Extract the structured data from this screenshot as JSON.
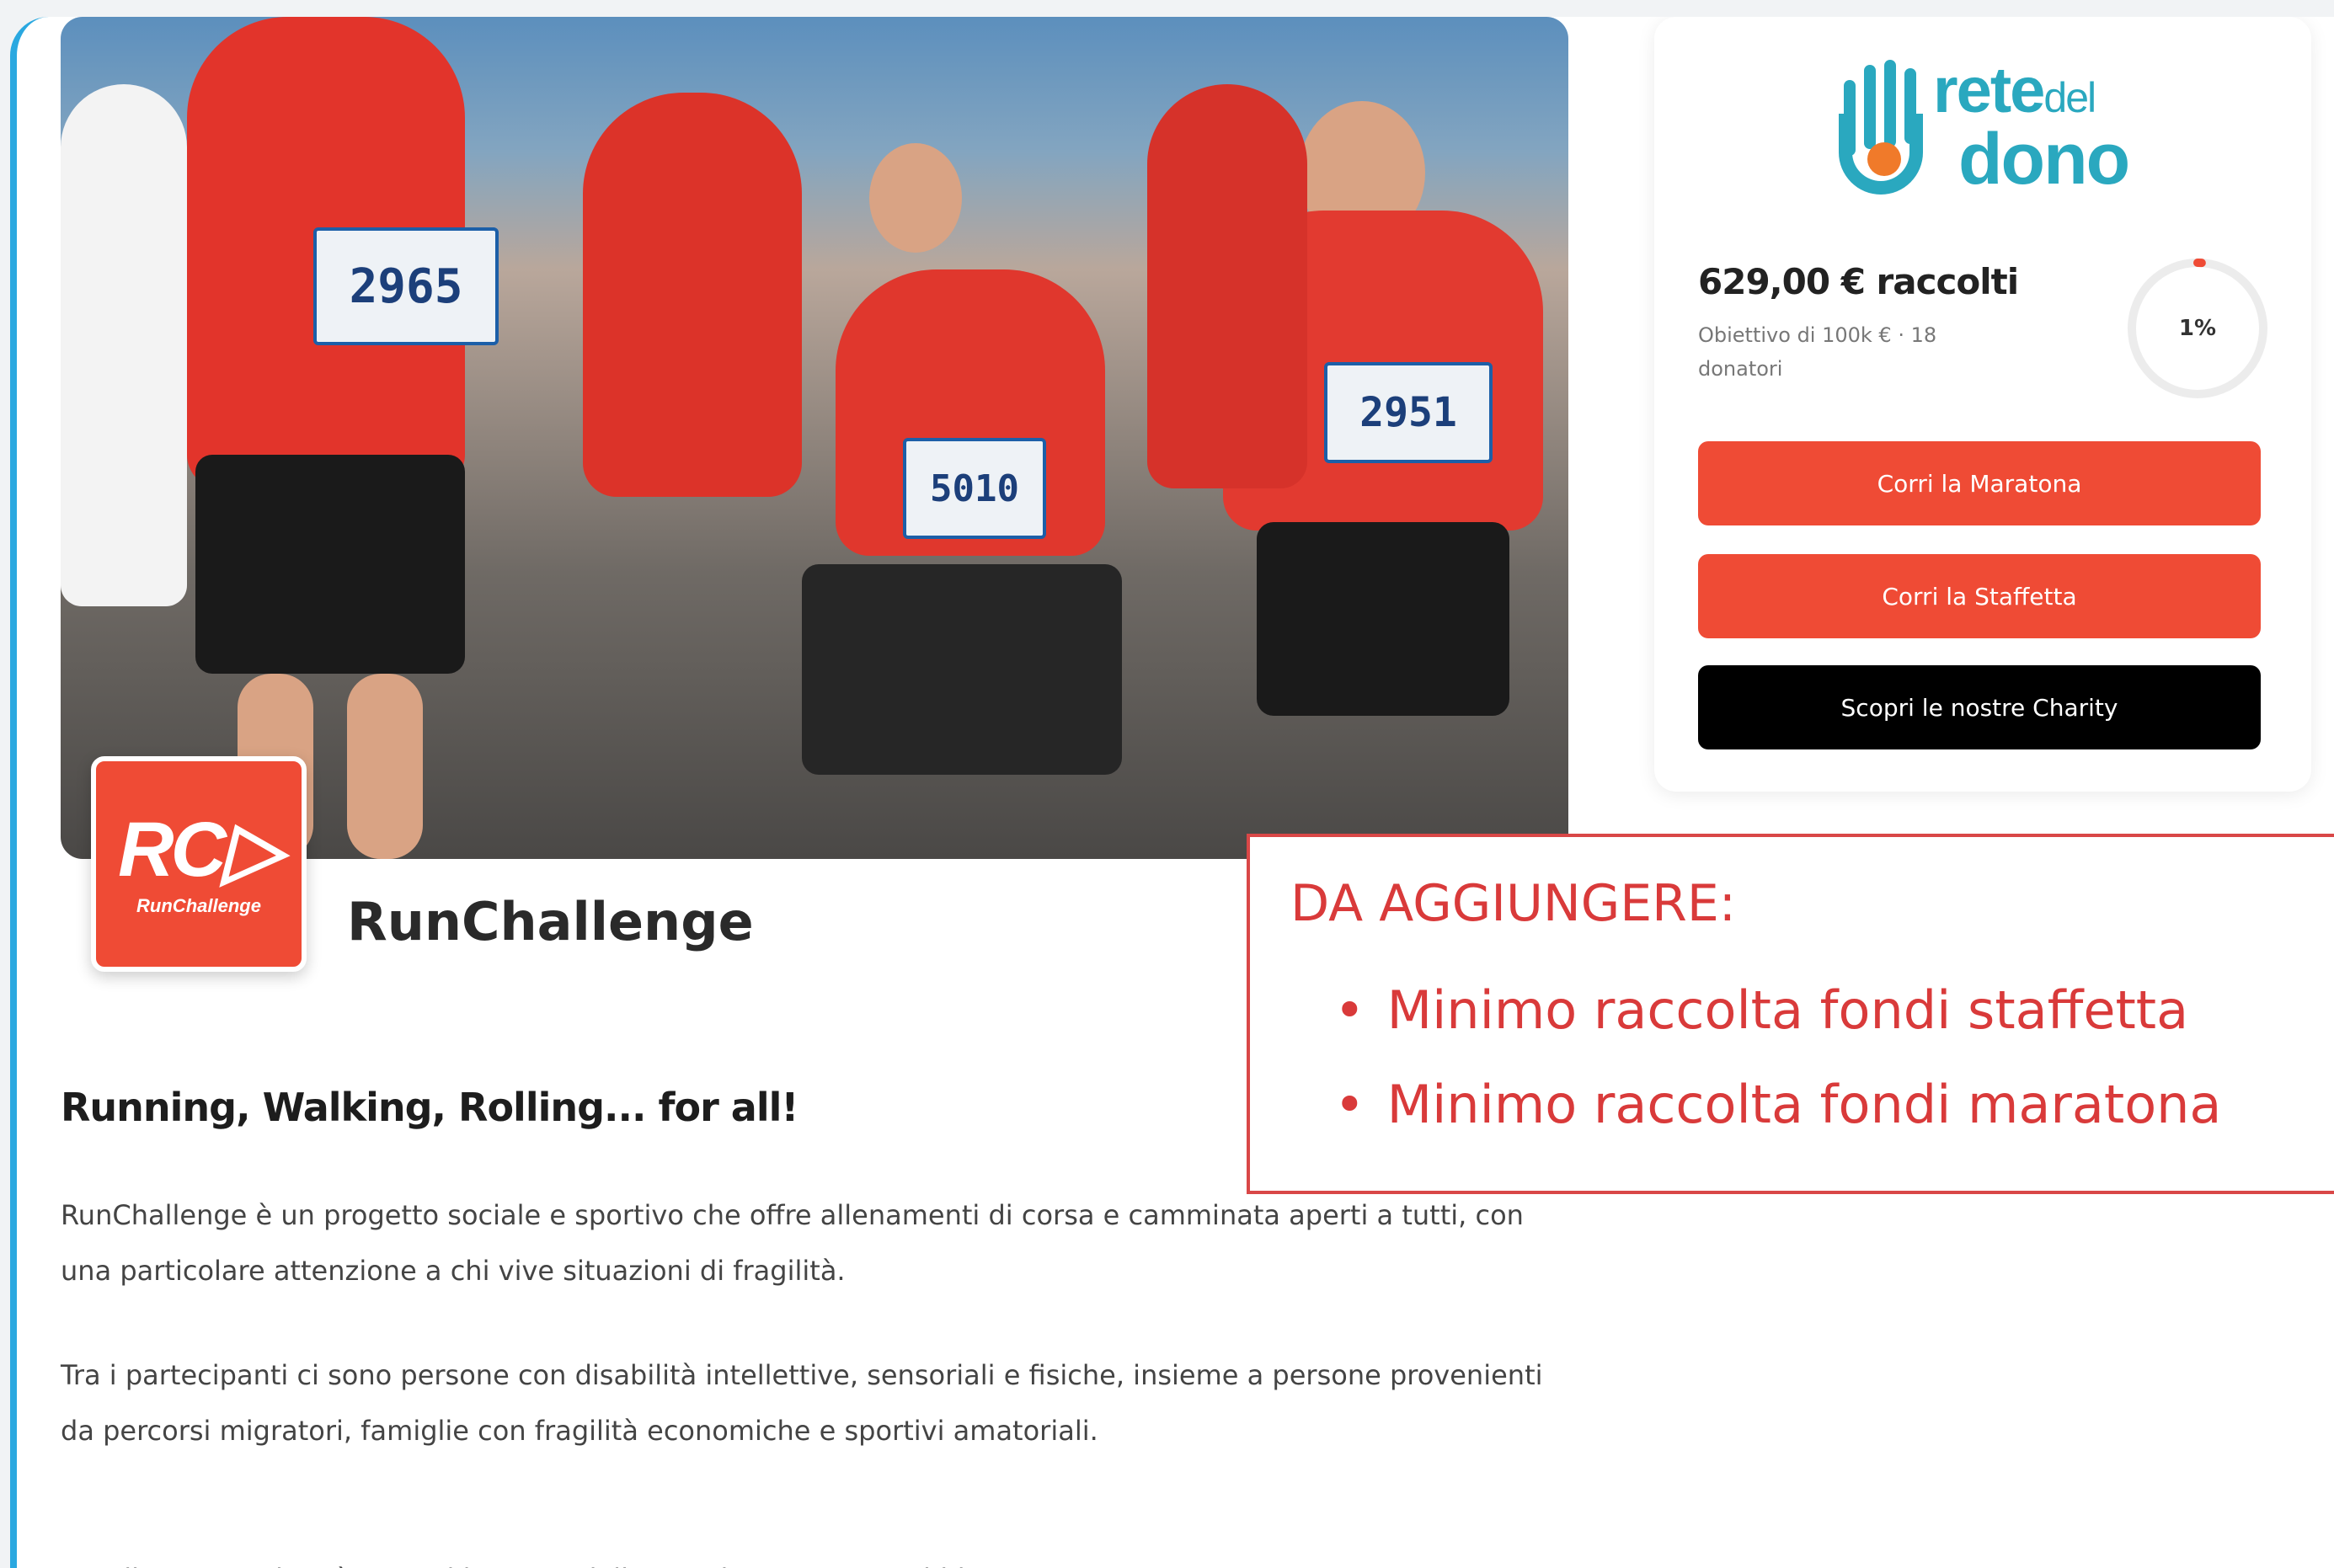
{
  "hero": {
    "bibs": [
      "2965",
      "5010",
      "2951"
    ]
  },
  "organization": {
    "logo_mark": "RC▷",
    "logo_sub": "RunChallenge",
    "name": "RunChallenge"
  },
  "donation_card": {
    "brand_line1": "rete",
    "brand_line1_small": "del",
    "brand_line2": "dono",
    "raised": "629,00 € raccolti",
    "goal": "Obiettivo di 100k € · 18 donatori",
    "progress_label": "1%",
    "progress_fraction": 0.01,
    "buttons": [
      {
        "label": "Corri la Maratona"
      },
      {
        "label": "Corri la Staffetta"
      },
      {
        "label": "Scopri le nostre Charity"
      }
    ]
  },
  "annotation": {
    "title": "DA AGGIUNGERE:",
    "items": [
      "Minimo raccolta fondi staffetta",
      "Minimo raccolta fondi maratona"
    ]
  },
  "content": {
    "tagline": "Running, Walking, Rolling... for all!",
    "paragraph1": "RunChallenge è un progetto sociale e sportivo che offre allenamenti di corsa e camminata aperti a tutti, con una particolare attenzione a chi vive situazioni di fragilità.",
    "paragraph2": "Tra i partecipanti ci sono persone con disabilità intellettive, sensoriali e fisiche, insieme a persone provenienti da percorsi migratori, famiglie con fragilità economiche e sportivi amatoriali.",
    "paragraph3": "La Milano Marathon è per noi l'evento dell'anno: l'anno scorso abbiamo preso parte"
  },
  "colors": {
    "accent": "#ef4b35",
    "brand": "#2aa8bf",
    "frame": "#2aa8e0",
    "annotation": "#d93a3a"
  }
}
